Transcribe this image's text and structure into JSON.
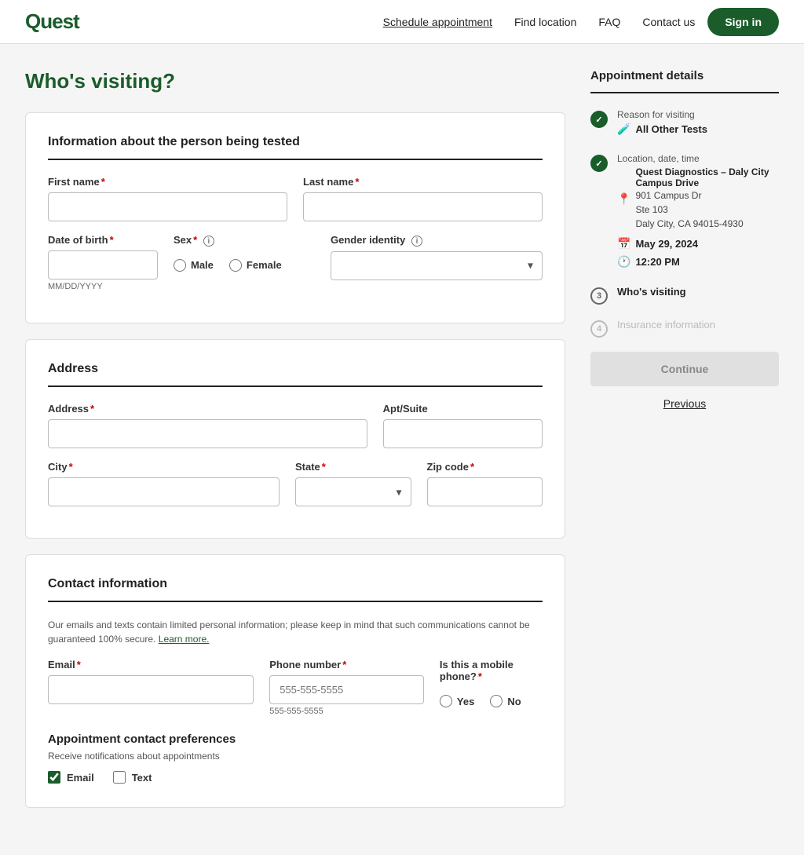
{
  "nav": {
    "logo": "Quest",
    "links": [
      {
        "label": "Schedule appointment",
        "active": true
      },
      {
        "label": "Find location",
        "active": false
      },
      {
        "label": "FAQ",
        "active": false
      },
      {
        "label": "Contact us",
        "active": false
      }
    ],
    "signin": "Sign in"
  },
  "page": {
    "title": "Who's visiting?"
  },
  "personal_info": {
    "section_title": "Information about the person being tested",
    "first_name_label": "First name",
    "last_name_label": "Last name",
    "dob_label": "Date of birth",
    "dob_hint": "MM/DD/YYYY",
    "sex_label": "Sex",
    "sex_options": [
      "Male",
      "Female"
    ],
    "gender_label": "Gender identity"
  },
  "address": {
    "section_title": "Address",
    "address_label": "Address",
    "apt_label": "Apt/Suite",
    "city_label": "City",
    "state_label": "State",
    "zip_label": "Zip code"
  },
  "contact": {
    "section_title": "Contact information",
    "notice": "Our emails and texts contain limited personal information; please keep in mind that such communications cannot be guaranteed 100% secure.",
    "learn_more": "Learn more.",
    "email_label": "Email",
    "phone_label": "Phone number",
    "phone_placeholder": "555-555-5555",
    "mobile_label": "Is this a mobile phone?",
    "mobile_options": [
      "Yes",
      "No"
    ],
    "prefs_title": "Appointment contact preferences",
    "prefs_notice": "Receive notifications about appointments",
    "pref_options": [
      "Email",
      "Text"
    ]
  },
  "sidebar": {
    "title": "Appointment details",
    "steps": [
      {
        "status": "completed",
        "label": "Reason for visiting",
        "icon": "tube-icon",
        "detail": "All Other Tests"
      },
      {
        "status": "completed",
        "label": "Location, date, time",
        "location_icon": "pin-icon",
        "location_name": "Quest Diagnostics – Daly City",
        "location_sub": "Campus Drive",
        "address1": "901 Campus Dr",
        "address2": "Ste 103",
        "address3": "Daly City, CA 94015-4930",
        "calendar_icon": "calendar-icon",
        "date": "May 29, 2024",
        "clock_icon": "clock-icon",
        "time": "12:20 PM"
      },
      {
        "status": "active",
        "number": "3",
        "label": "Who's visiting"
      },
      {
        "status": "inactive",
        "number": "4",
        "label": "Insurance information"
      }
    ],
    "continue_btn": "Continue",
    "previous_btn": "Previous"
  }
}
